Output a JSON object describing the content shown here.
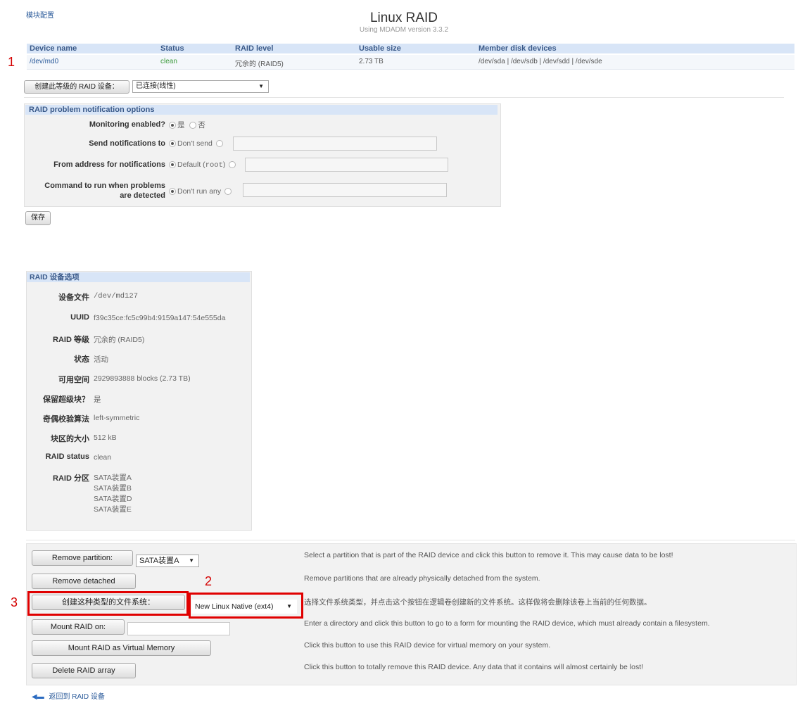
{
  "nav": {
    "module_config": "模块配置"
  },
  "header": {
    "title": "Linux RAID",
    "subtitle": "Using MDADM version 3.3.2"
  },
  "raid_table": {
    "columns": [
      "Device name",
      "Status",
      "RAID level",
      "Usable size",
      "Member disk devices"
    ],
    "rows": [
      {
        "device": "/dev/md0",
        "status": "clean",
        "level": "冗余的 (RAID5)",
        "size": "2.73 TB",
        "members": "/dev/sda | /dev/sdb | /dev/sdd | /dev/sde"
      }
    ]
  },
  "create_level": {
    "button_label": "创建此等级的 RAID 设备：",
    "selected": "已连接(线性)"
  },
  "notify": {
    "title": "RAID problem notification options",
    "monitoring_label": "Monitoring enabled?",
    "monitoring_yes": "是",
    "monitoring_no": "否",
    "send_label": "Send notifications to",
    "send_default": "Don't send",
    "from_label": "From address for notifications",
    "from_default_prefix": "Default (",
    "from_default_code": "root",
    "from_default_suffix": ")",
    "command_label_1": "Command to run when problems",
    "command_label_2": "are detected",
    "command_default": "Don't run any"
  },
  "save_button": "保存",
  "device_options": {
    "title": "RAID 设备选项",
    "device_file_label": "设备文件",
    "device_file": "/dev/md127",
    "uuid_label": "UUID",
    "uuid": "f39c35ce:fc5c99b4:9159a147:54e555da",
    "level_label": "RAID 等级",
    "level": "冗余的 (RAID5)",
    "state_label": "状态",
    "state": "活动",
    "space_label": "可用空间",
    "space": "2929893888 blocks (2.73 TB)",
    "superblock_label": "保留超级块？",
    "superblock": "是",
    "parity_label": "奇偶校验算法",
    "parity": "left-symmetric",
    "chunk_label": "块区的大小",
    "chunk": "512 kB",
    "status_label": "RAID status",
    "status": "clean",
    "partitions_label": "RAID 分区",
    "partitions": [
      "SATA装置A",
      "SATA装置B",
      "SATA装置D",
      "SATA装置E"
    ]
  },
  "actions": {
    "remove_partition": "Remove partition:",
    "remove_partition_select": "SATA装置A",
    "remove_partition_desc": "Select a partition that is part of the RAID device and click this button to remove it. This may cause data to be lost!",
    "remove_detached": "Remove detached",
    "remove_detached_desc": "Remove partitions that are already physically detached from the system.",
    "create_fs": "创建这种类型的文件系统：",
    "create_fs_select": "New Linux Native (ext4)",
    "create_fs_desc": "选择文件系统类型，并点击这个按钮在逻辑卷创建新的文件系统。这样做将会删除该卷上当前的任何数据。",
    "mount_on": "Mount RAID on:",
    "mount_on_desc": "Enter a directory and click this button to go to a form for mounting the RAID device, which must already contain a filesystem.",
    "mount_vm": "Mount RAID as Virtual Memory",
    "mount_vm_desc": "Click this button to use this RAID device for virtual memory on your system.",
    "delete": "Delete RAID array",
    "delete_desc": "Click this button to totally remove this RAID device. Any data that it contains will almost certainly be lost!"
  },
  "back_link": "返回到 RAID 设备",
  "annotations": {
    "n1": "1",
    "n2": "2",
    "n3": "3"
  },
  "colors": {
    "header_blue": "#d8e5f7",
    "clean_green": "#3a9a3a",
    "highlight_red": "#e00000"
  }
}
